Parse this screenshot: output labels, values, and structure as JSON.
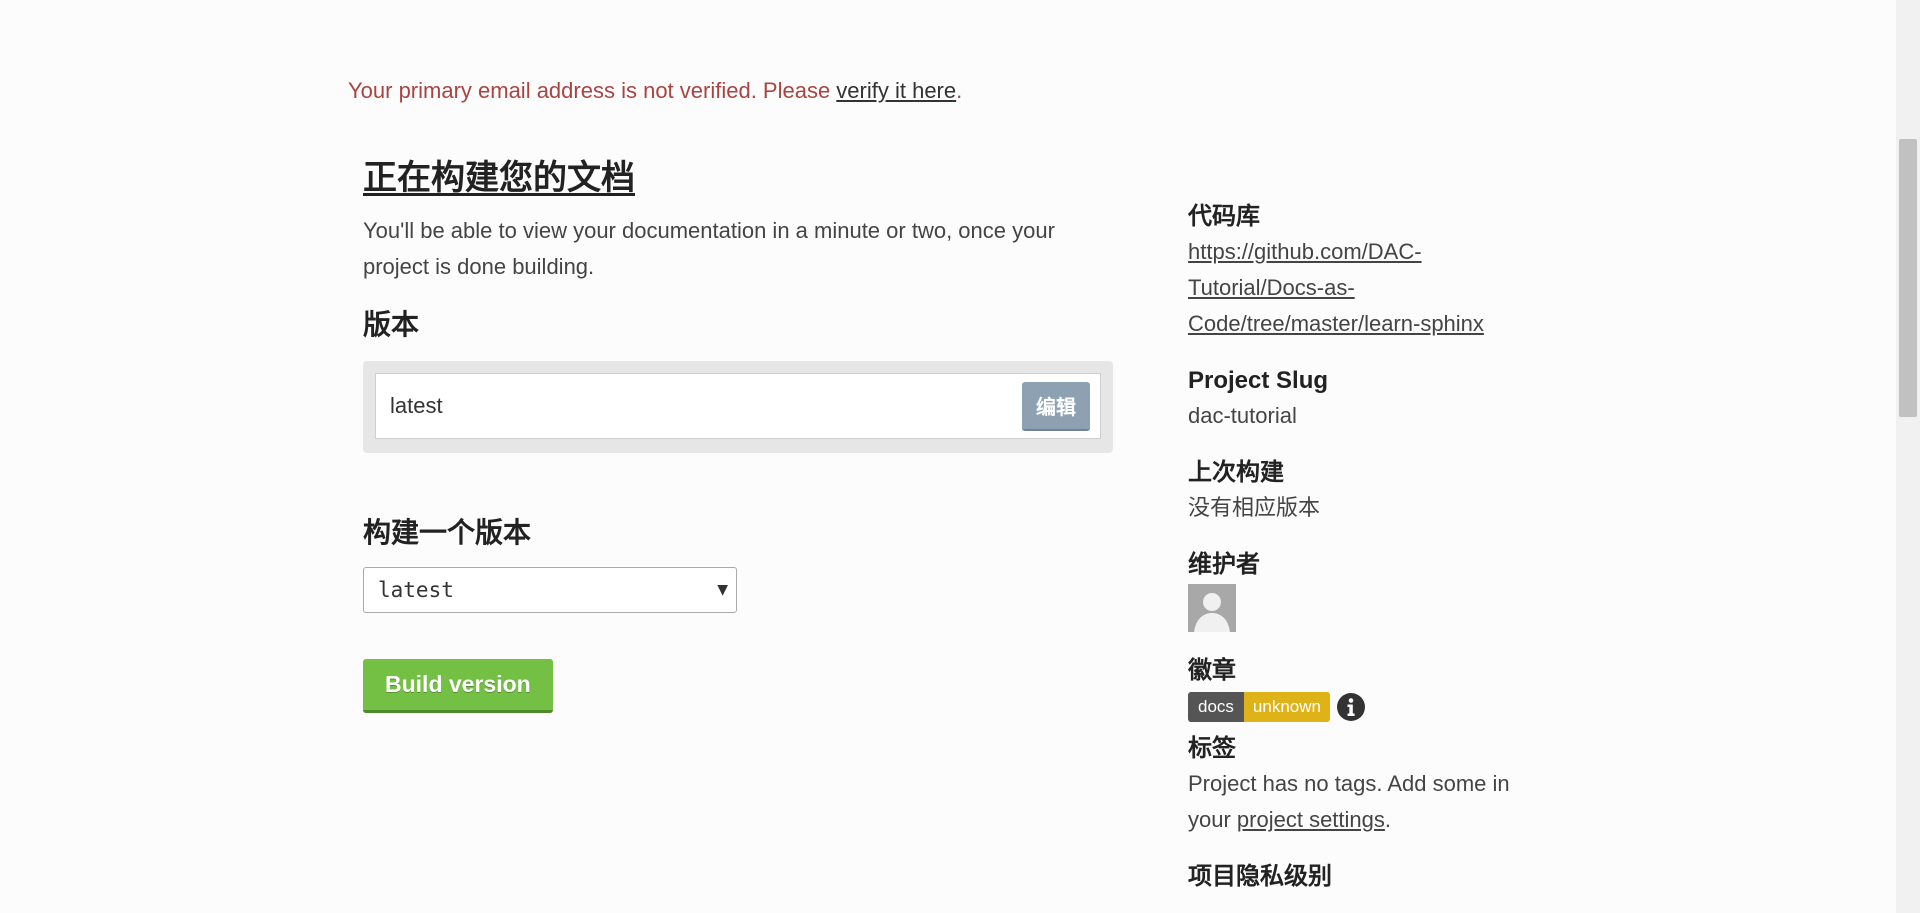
{
  "notice": {
    "text": "Your primary email address is not verified. Please ",
    "link_text": "verify it here",
    "suffix": "."
  },
  "main": {
    "title": "正在构建您的文档",
    "intro": "You'll be able to view your documentation in a minute or two, once your project is done building.",
    "versions_heading": "版本",
    "version_name": "latest",
    "edit_label": "编辑",
    "build_heading": "构建一个版本",
    "selected_version": "latest",
    "build_button_label": "Build version"
  },
  "side": {
    "repo_label": "代码库",
    "repo_url": "https://github.com/DAC-Tutorial/Docs-as-Code/tree/master/learn-sphinx",
    "slug_label": "Project Slug",
    "slug_value": "dac-tutorial",
    "last_build_label": "上次构建",
    "last_build_value": "没有相应版本",
    "maintainers_label": "维护者",
    "badge_label": "徽章",
    "badge_left": "docs",
    "badge_right": "unknown",
    "tags_label": "标签",
    "tags_text": "Project has no tags. Add some in your ",
    "tags_link": "project settings",
    "tags_suffix": ".",
    "privacy_label": "项目隐私级别"
  },
  "colors": {
    "notice": "#a94442",
    "build_button": "#74c045",
    "edit_button": "#8da1b2",
    "badge_left": "#555555",
    "badge_right": "#dfb317"
  },
  "icons": {
    "info": "info-icon",
    "avatar": "user-avatar-placeholder",
    "select_caret": "caret-down-icon"
  }
}
